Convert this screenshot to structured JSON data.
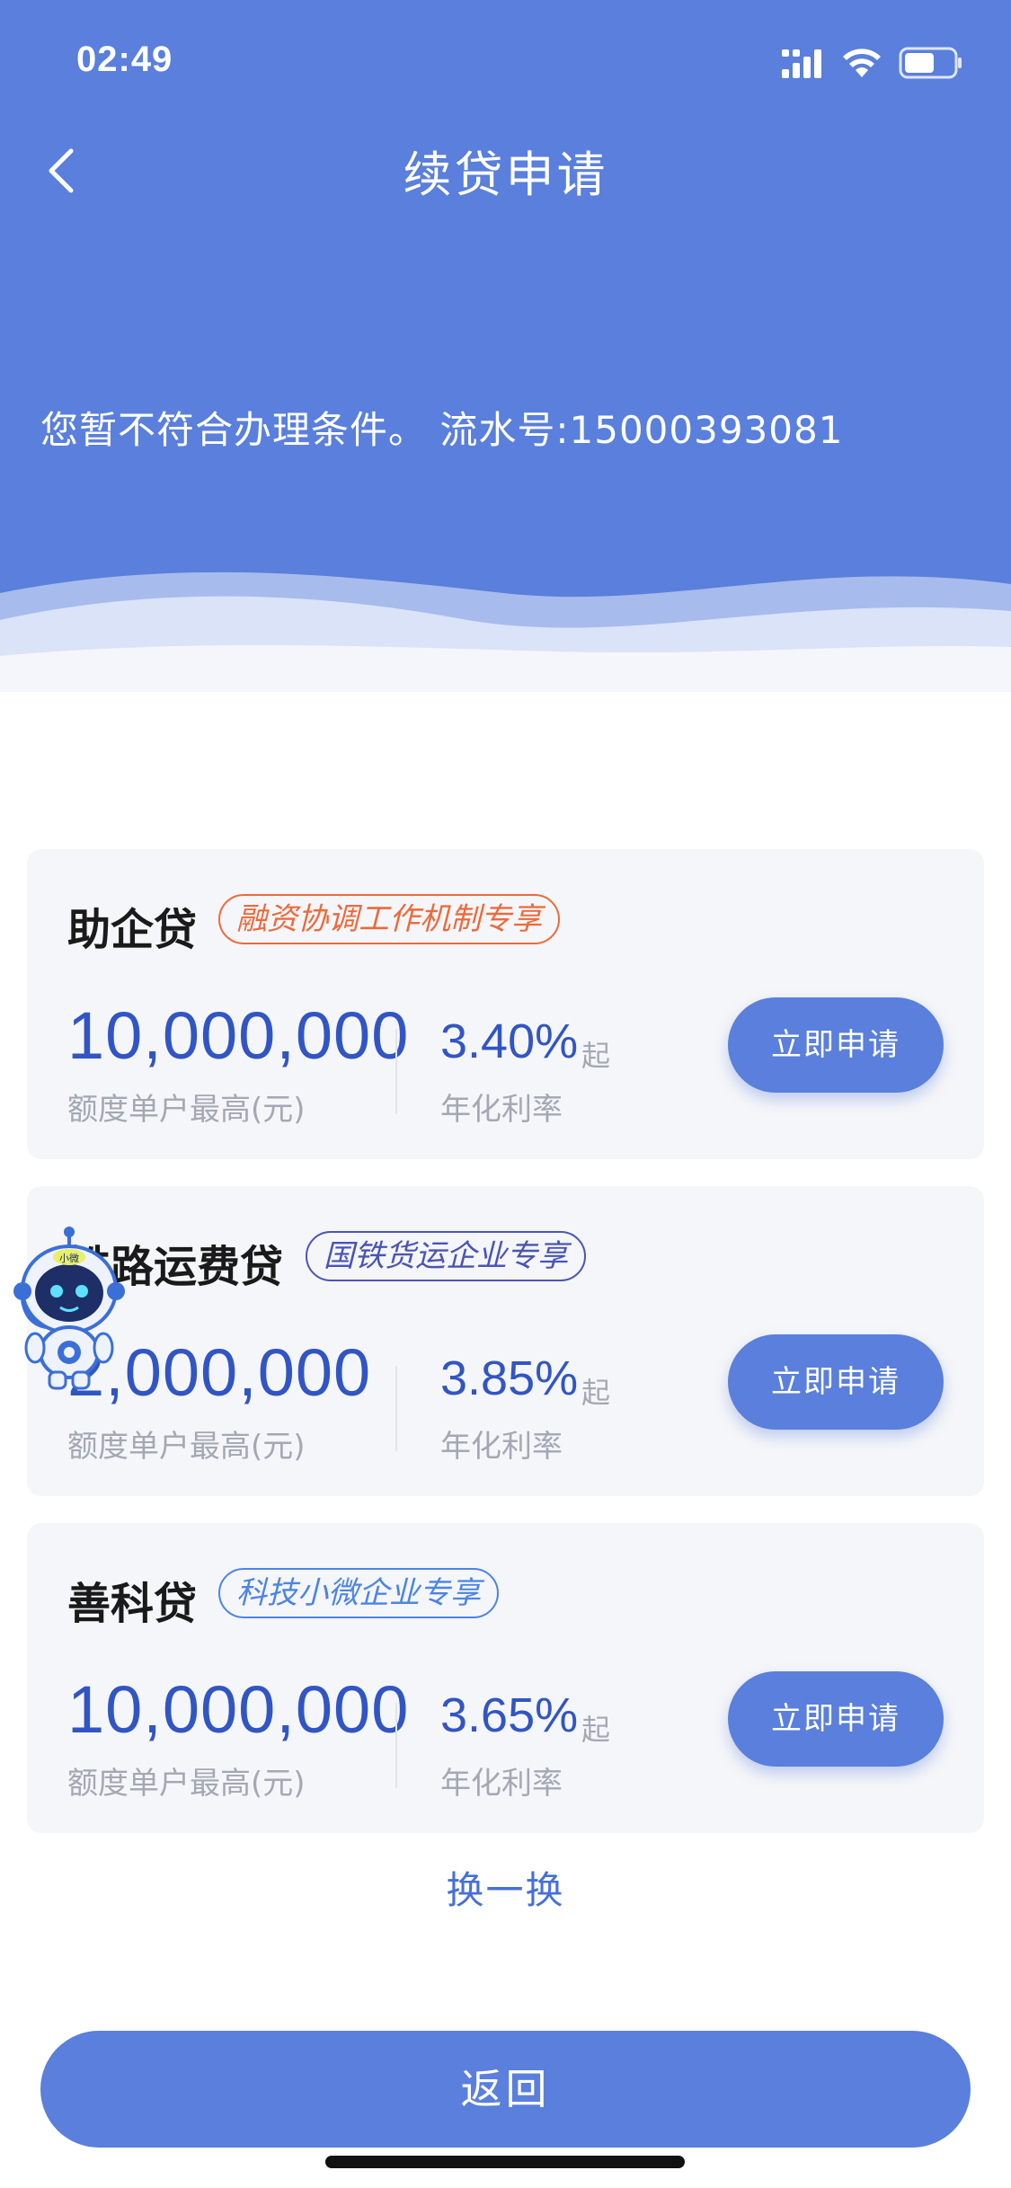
{
  "status_bar": {
    "time": "02:49",
    "icons": [
      "signal-icon",
      "wifi-icon",
      "battery-icon"
    ]
  },
  "header": {
    "title": "续贷申请",
    "back_icon": "chevron-left-icon"
  },
  "notice": {
    "text": "您暂不符合办理条件。 流水号:15000393081"
  },
  "products": [
    {
      "name": "助企贷",
      "tag": "融资协调工作机制专享",
      "tag_color": "#ec6a3c",
      "amount": "10,000,000",
      "amount_label": "额度单户最高(元)",
      "rate": "3.40%",
      "rate_suffix": "起",
      "rate_label": "年化利率",
      "button": "立即申请"
    },
    {
      "name": "铁路运费贷",
      "tag": "国铁货运企业专享",
      "tag_color": "#4a54b6",
      "amount": "2,000,000",
      "amount_label": "额度单户最高(元)",
      "rate": "3.85%",
      "rate_suffix": "起",
      "rate_label": "年化利率",
      "button": "立即申请"
    },
    {
      "name": "善科贷",
      "tag": "科技小微企业专享",
      "tag_color": "#4c84e6",
      "amount": "10,000,000",
      "amount_label": "额度单户最高(元)",
      "rate": "3.65%",
      "rate_suffix": "起",
      "rate_label": "年化利率",
      "button": "立即申请"
    }
  ],
  "swap_link": "换一换",
  "back_button": "返回",
  "assistant": {
    "icon": "robot-assistant-icon",
    "badge": "小微"
  },
  "colors": {
    "brand": "#5a7fdc",
    "amount_text": "#3155c4",
    "card_bg": "#f5f6f9"
  }
}
